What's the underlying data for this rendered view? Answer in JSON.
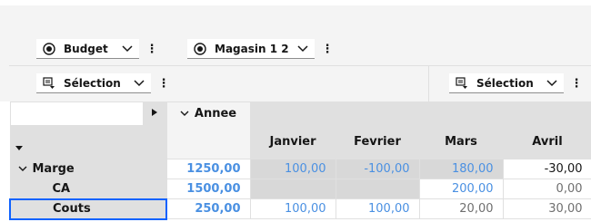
{
  "filters": {
    "budget_label": "Budget",
    "store_label": "Magasin 1 2"
  },
  "selections": {
    "left_label": "Sélection",
    "right_label": "Sélection"
  },
  "grid": {
    "year_header": "Annee",
    "months": [
      "Janvier",
      "Fevrier",
      "Mars",
      "Avril"
    ],
    "rows": [
      {
        "label": "Marge",
        "annee": "1250,00",
        "values": [
          "100,00",
          "-100,00",
          "180,00",
          "-30,00"
        ]
      },
      {
        "label": "CA",
        "annee": "1500,00",
        "values": [
          "",
          "",
          "200,00",
          "0,00"
        ]
      },
      {
        "label": "Couts",
        "annee": "250,00",
        "values": [
          "100,00",
          "100,00",
          "20,00",
          "30,00"
        ]
      }
    ]
  },
  "colors": {
    "accent_blue": "#4a90e2",
    "header_grey": "#e0e0e0",
    "focus_border": "#0f62fe"
  }
}
